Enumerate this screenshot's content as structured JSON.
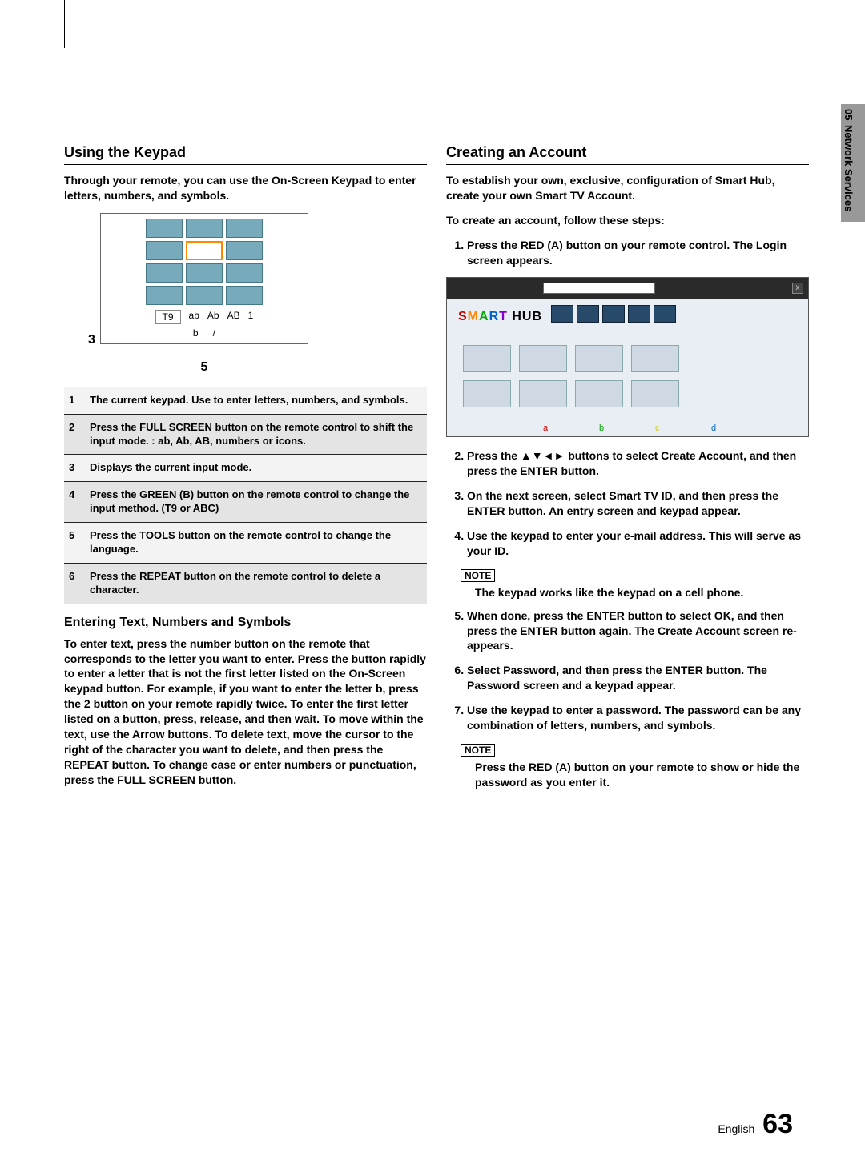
{
  "side_tab": {
    "num": "05",
    "text": "Network Services"
  },
  "left": {
    "h_keypad": "Using the Keypad",
    "intro": "Through your remote, you can use the On-Screen Keypad to enter letters, numbers, and symbols.",
    "callout3": "3",
    "callout5": "5",
    "mode_row": [
      "T9",
      "ab",
      "Ab",
      "AB",
      "1"
    ],
    "btn_row": [
      "b",
      "",
      "/",
      ""
    ],
    "legend": [
      {
        "n": "1",
        "t": "The current keypad.\nUse to enter letters, numbers, and symbols."
      },
      {
        "n": "2",
        "t": "Press the FULL SCREEN button on the remote control to shift the input mode.\n: ab, Ab, AB, numbers or icons."
      },
      {
        "n": "3",
        "t": "Displays the current input mode."
      },
      {
        "n": "4",
        "t": "Press the GREEN (B) button on the remote control to change the input method. (T9 or ABC)"
      },
      {
        "n": "5",
        "t": "Press the TOOLS button on the remote control to change the language."
      },
      {
        "n": "6",
        "t": "Press the REPEAT button on the remote control to delete a character."
      }
    ],
    "h_enter": "Entering Text, Numbers and Symbols",
    "enter_body": "To enter text, press the number button on the remote that corresponds to the letter you want to enter. Press the button rapidly to enter a letter that is not the first letter listed on the On-Screen keypad button. For example, if you want to enter the letter b, press the 2 button on your remote rapidly twice. To enter the first letter listed on a button, press, release, and then wait.\nTo move within the text, use the Arrow buttons. To delete text, move the cursor to the right of the character you want to delete, and then press the REPEAT button. To change case or enter numbers or punctuation, press the FULL SCREEN button."
  },
  "right": {
    "h_create": "Creating an Account",
    "intro1": "To establish your own, exclusive, configuration of Smart Hub, create your own Smart TV Account.",
    "intro2": "To create an account, follow these steps:",
    "steps": [
      "Press the RED (A) button on your remote control. The Login screen appears.",
      "Press the ▲▼◄► buttons to select Create Account, and then press the ENTER button.",
      "On the next screen, select Smart TV ID, and then press the ENTER button. An entry screen and keypad appear.",
      "Use the keypad to enter your e-mail address. This will serve as your ID."
    ],
    "note1_label": "NOTE",
    "note1": "The keypad works like the keypad on a cell phone.",
    "steps2": [
      "When done, press the ENTER button to select OK, and then press the ENTER button again. The Create Account screen re-appears.",
      "Select Password, and then press the ENTER button. The Password screen and a keypad appear.",
      "Use the keypad to enter a password. The password can be any combination of letters, numbers, and symbols."
    ],
    "note2_label": "NOTE",
    "note2": "Press the RED (A) button on your remote to show or hide the password as you enter it.",
    "ui": {
      "logo": "SMART HUB",
      "close": "x",
      "abcd": [
        "a",
        "b",
        "c",
        "d"
      ]
    }
  },
  "footer": {
    "lang": "English",
    "page": "63"
  }
}
